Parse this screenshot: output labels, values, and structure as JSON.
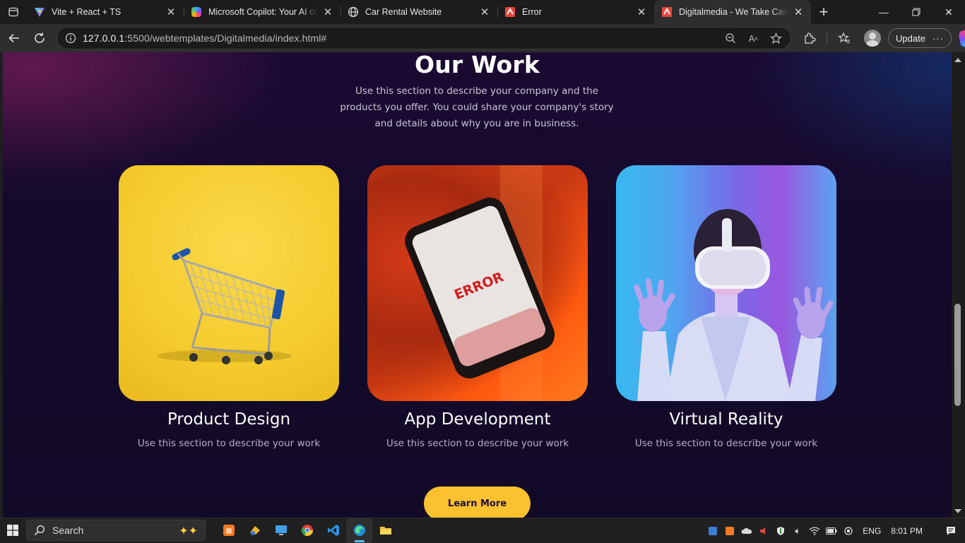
{
  "browser": {
    "tabs": [
      {
        "title": "Vite + React + TS",
        "favicon": "vite-icon",
        "active": false
      },
      {
        "title": "Microsoft Copilot: Your AI companion",
        "favicon": "copilot-icon",
        "active": false
      },
      {
        "title": "Car Rental Website",
        "favicon": "globe-icon",
        "active": false
      },
      {
        "title": "Error",
        "favicon": "site-logo-icon",
        "active": false
      },
      {
        "title": "Digitalmedia - We Take Care of",
        "favicon": "site-logo-icon",
        "active": true
      }
    ],
    "url_host": "127.0.0.1",
    "url_path": ":5500/webtemplates/Digitalmedia/index.html#",
    "update_label": "Update"
  },
  "page": {
    "section_title": "Our Work",
    "section_description": "Use this section to describe your company and the products you offer. You could share your company's story and details about why you are in business.",
    "cards": [
      {
        "title": "Product Design",
        "description": "Use this section to describe your work",
        "image": "shopping-cart-on-yellow"
      },
      {
        "title": "App Development",
        "description": "Use this section to describe your work",
        "image": "phone-showing-error"
      },
      {
        "title": "Virtual Reality",
        "description": "Use this section to describe your work",
        "image": "person-with-vr-headset"
      }
    ],
    "phone_screen_text": "ERROR",
    "learn_more_label": "Learn More",
    "colors": {
      "accent": "#fcc12e",
      "background": "#150a2c"
    }
  },
  "taskbar": {
    "search_placeholder": "Search",
    "language": "ENG",
    "time": "8:01 PM"
  }
}
